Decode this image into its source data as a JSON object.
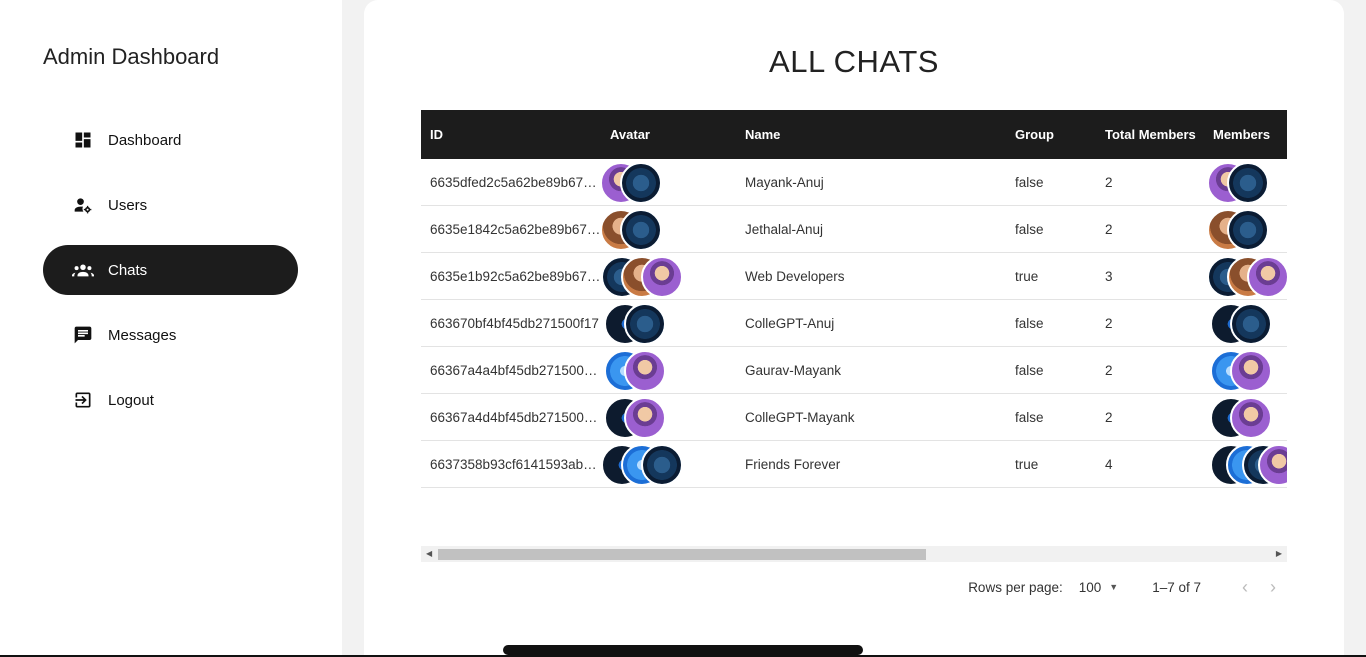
{
  "sidebar": {
    "brand": "Admin Dashboard",
    "items": [
      {
        "label": "Dashboard",
        "icon": "dashboard-icon",
        "active": false
      },
      {
        "label": "Users",
        "icon": "manage-accounts-icon",
        "active": false
      },
      {
        "label": "Chats",
        "icon": "groups-icon",
        "active": true
      },
      {
        "label": "Messages",
        "icon": "message-icon",
        "active": false
      },
      {
        "label": "Logout",
        "icon": "logout-icon",
        "active": false
      }
    ]
  },
  "main": {
    "title": "ALL CHATS",
    "table": {
      "columns": [
        "ID",
        "Avatar",
        "Name",
        "Group",
        "Total Members",
        "Members"
      ],
      "rows": [
        {
          "id": "6635dfed2c5a62be89b67…",
          "name": "Mayank-Anuj",
          "group": "false",
          "total": "2",
          "avatars": [
            "purple",
            "globe"
          ],
          "members": [
            "purple",
            "globe"
          ]
        },
        {
          "id": "6635e1842c5a62be89b67…",
          "name": "Jethalal-Anuj",
          "group": "false",
          "total": "2",
          "avatars": [
            "brown",
            "globe"
          ],
          "members": [
            "brown",
            "globe"
          ]
        },
        {
          "id": "6635e1b92c5a62be89b67…",
          "name": "Web Developers",
          "group": "true",
          "total": "3",
          "avatars": [
            "globe",
            "brown",
            "purple"
          ],
          "members": [
            "globe",
            "brown",
            "purple"
          ]
        },
        {
          "id": "663670bf4bf45db271500f17",
          "name": "ColleGPT-Anuj",
          "group": "false",
          "total": "2",
          "avatars": [
            "dark",
            "globe"
          ],
          "members": [
            "dark",
            "globe"
          ]
        },
        {
          "id": "66367a4a4bf45db271500…",
          "name": "Gaurav-Mayank",
          "group": "false",
          "total": "2",
          "avatars": [
            "blue",
            "purple"
          ],
          "members": [
            "blue",
            "purple"
          ]
        },
        {
          "id": "66367a4d4bf45db271500…",
          "name": "ColleGPT-Mayank",
          "group": "false",
          "total": "2",
          "avatars": [
            "dark",
            "purple"
          ],
          "members": [
            "dark",
            "purple"
          ]
        },
        {
          "id": "6637358b93cf6141593ab…",
          "name": "Friends Forever",
          "group": "true",
          "total": "4",
          "avatars": [
            "dark",
            "blue",
            "globe"
          ],
          "members": [
            "dark",
            "blue",
            "globe",
            "purple"
          ]
        }
      ]
    },
    "pagination": {
      "rows_per_page_label": "Rows per page:",
      "rows_per_page_value": "100",
      "range": "1–7 of 7",
      "prev": "‹",
      "next": "›"
    }
  }
}
